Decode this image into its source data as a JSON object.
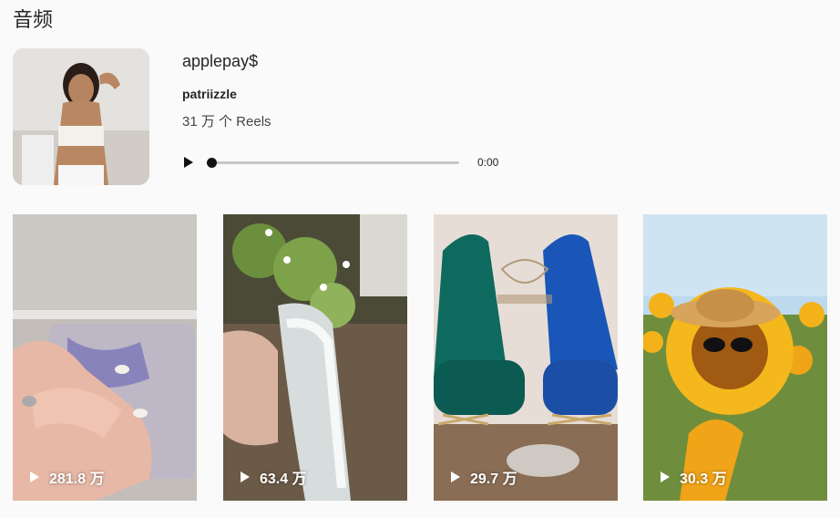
{
  "page": {
    "title": "音频"
  },
  "audio": {
    "name": "applepay$",
    "artist": "patriizzle",
    "reels_count": "31 万 个 Reels",
    "time": "0:00",
    "progress": 0
  },
  "reels": [
    {
      "views": "281.8 万"
    },
    {
      "views": "63.4 万"
    },
    {
      "views": "29.7 万"
    },
    {
      "views": "30.3 万"
    }
  ],
  "icons": {
    "play": "play-icon"
  }
}
